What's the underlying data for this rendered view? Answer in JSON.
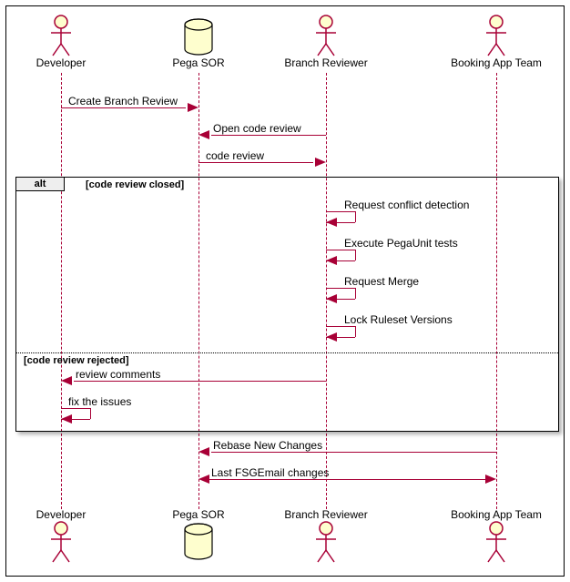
{
  "actors": {
    "developer": "Developer",
    "pegasor": "Pega SOR",
    "reviewer": "Branch Reviewer",
    "booking": "Booking App Team"
  },
  "messages": {
    "create_branch_review": "Create Branch Review",
    "open_code_review": "Open code review",
    "code_review": "code review",
    "request_conflict": "Request conflict detection",
    "execute_pegaunit": "Execute PegaUnit tests",
    "request_merge": "Request Merge",
    "lock_ruleset": "Lock Ruleset Versions",
    "review_comments": "review comments",
    "fix_issues": "fix the issues",
    "rebase": "Rebase New Changes",
    "last_fsg": "Last FSGEmail changes"
  },
  "alt": {
    "tag": "alt",
    "guard1": "[code review closed]",
    "guard2": "[code review rejected]"
  },
  "chart_data": {
    "type": "sequence_diagram",
    "participants": [
      {
        "name": "Developer",
        "kind": "actor"
      },
      {
        "name": "Pega SOR",
        "kind": "database"
      },
      {
        "name": "Branch Reviewer",
        "kind": "actor"
      },
      {
        "name": "Booking App Team",
        "kind": "actor"
      }
    ],
    "interactions": [
      {
        "from": "Developer",
        "to": "Pega SOR",
        "label": "Create Branch Review"
      },
      {
        "from": "Branch Reviewer",
        "to": "Pega SOR",
        "label": "Open code review"
      },
      {
        "from": "Pega SOR",
        "to": "Branch Reviewer",
        "label": "code review"
      },
      {
        "alt": [
          {
            "guard": "code review closed",
            "steps": [
              {
                "from": "Branch Reviewer",
                "to": "Branch Reviewer",
                "label": "Request conflict detection"
              },
              {
                "from": "Branch Reviewer",
                "to": "Branch Reviewer",
                "label": "Execute PegaUnit tests"
              },
              {
                "from": "Branch Reviewer",
                "to": "Branch Reviewer",
                "label": "Request Merge"
              },
              {
                "from": "Branch Reviewer",
                "to": "Branch Reviewer",
                "label": "Lock Ruleset Versions"
              }
            ]
          },
          {
            "guard": "code review rejected",
            "steps": [
              {
                "from": "Branch Reviewer",
                "to": "Developer",
                "label": "review comments"
              },
              {
                "from": "Developer",
                "to": "Developer",
                "label": "fix the issues"
              }
            ]
          }
        ]
      },
      {
        "from": "Booking App Team",
        "to": "Pega SOR",
        "label": "Rebase New Changes"
      },
      {
        "from": "Pega SOR",
        "to": "Booking App Team",
        "label": "Last FSGEmail changes",
        "bidirectional": true
      }
    ]
  }
}
